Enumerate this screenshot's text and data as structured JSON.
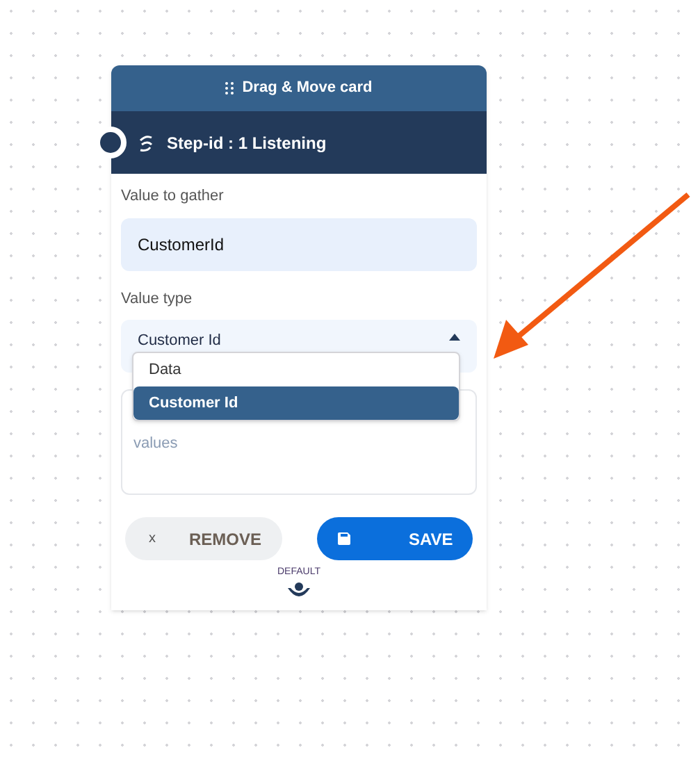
{
  "header": {
    "title": "Drag & Move card"
  },
  "step": {
    "title": "Step-id : 1 Listening"
  },
  "gather": {
    "label": "Value to gather",
    "value": "CustomerId"
  },
  "value_type": {
    "label": "Value type",
    "value": "Customer Id",
    "expanded": true,
    "options": [
      {
        "label": "Data",
        "selected": false
      },
      {
        "label": "Customer Id",
        "selected": true
      }
    ]
  },
  "textarea": {
    "placeholder": "values"
  },
  "buttons": [
    {
      "kind": "remove",
      "icon": "x",
      "label": "REMOVE"
    },
    {
      "kind": "save",
      "label": "SAVE"
    }
  ],
  "footer": {
    "label": "DEFAULT"
  }
}
